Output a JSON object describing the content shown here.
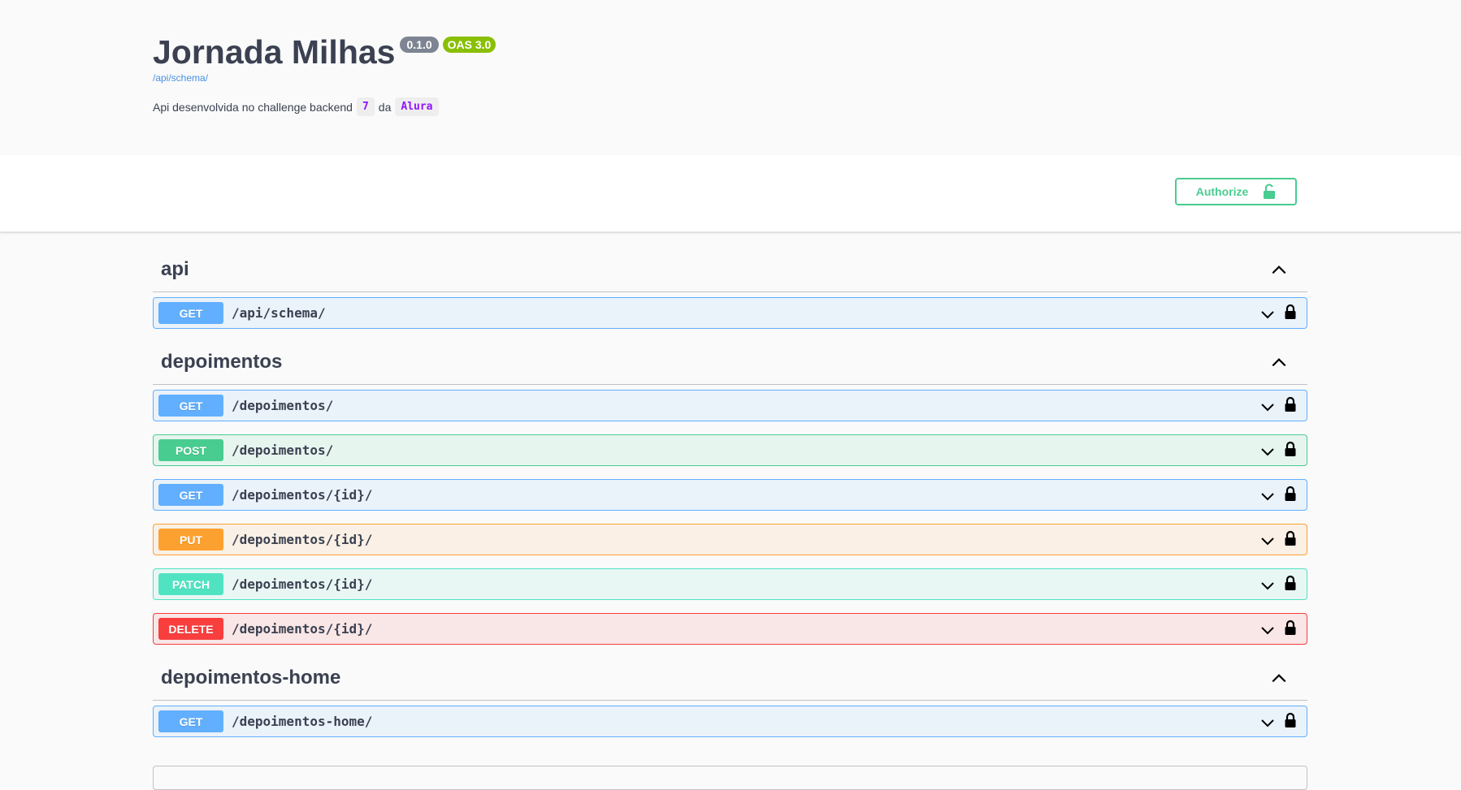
{
  "info": {
    "title": "Jornada Milhas",
    "version": "0.1.0",
    "oas_version": "OAS 3.0",
    "schema_link": "/api/schema/",
    "description_prefix": "Api desenvolvida no challenge backend",
    "description_code1": "7",
    "description_mid": "da",
    "description_code2": "Alura"
  },
  "authorize_label": "Authorize",
  "colors": {
    "get": "#61affe",
    "post": "#49cc90",
    "put": "#fca130",
    "patch": "#50e3c2",
    "delete": "#f93e3e",
    "authorize": "#49cc90"
  },
  "tags": [
    {
      "name": "api",
      "ops": [
        {
          "method": "GET",
          "path": "/api/schema/"
        }
      ]
    },
    {
      "name": "depoimentos",
      "ops": [
        {
          "method": "GET",
          "path": "/depoimentos/"
        },
        {
          "method": "POST",
          "path": "/depoimentos/"
        },
        {
          "method": "GET",
          "path": "/depoimentos/{id}/"
        },
        {
          "method": "PUT",
          "path": "/depoimentos/{id}/"
        },
        {
          "method": "PATCH",
          "path": "/depoimentos/{id}/"
        },
        {
          "method": "DELETE",
          "path": "/depoimentos/{id}/"
        }
      ]
    },
    {
      "name": "depoimentos-home",
      "ops": [
        {
          "method": "GET",
          "path": "/depoimentos-home/"
        }
      ]
    }
  ],
  "icons": {
    "tag_toggle": "chevron-up-icon",
    "op_expand": "chevron-down-icon",
    "op_lock": "lock-icon",
    "authorize": "unlock-icon"
  }
}
